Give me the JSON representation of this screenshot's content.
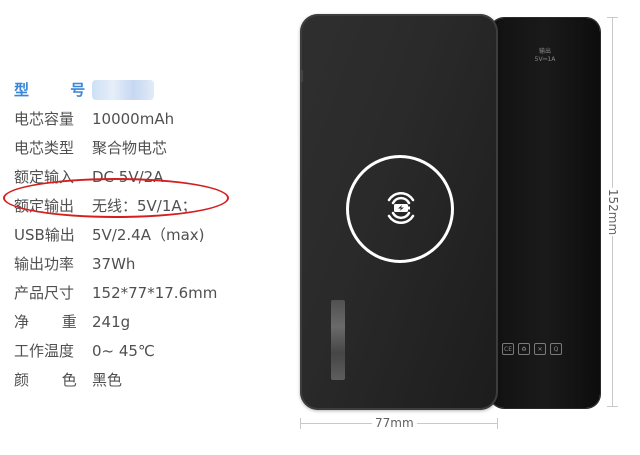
{
  "specs": [
    {
      "label": "型 号",
      "value": ""
    },
    {
      "label": "电芯容量",
      "value": "10000mAh"
    },
    {
      "label": "电芯类型",
      "value": "聚合物电芯"
    },
    {
      "label": "额定输入",
      "value": "DC 5V/2A"
    },
    {
      "label": "额定输出",
      "value": "无线：5V/1A；"
    },
    {
      "label": "USB输出",
      "value": "5V/2.4A（max)"
    },
    {
      "label": "输出功率",
      "value": "37Wh"
    },
    {
      "label": "产品尺寸",
      "value": "152*77*17.6mm"
    },
    {
      "label": "净 重",
      "value": "241g"
    },
    {
      "label": "工作温度",
      "value": "0~ 45℃"
    },
    {
      "label": "颜 色",
      "value": "黑色"
    }
  ],
  "dimensions": {
    "width": "77mm",
    "height": "152mm"
  },
  "back_label": {
    "line1": "输出",
    "line2": "5V⎓1A"
  },
  "colors": {
    "highlight": "#d41f1f",
    "model_label": "#3a86d8"
  }
}
